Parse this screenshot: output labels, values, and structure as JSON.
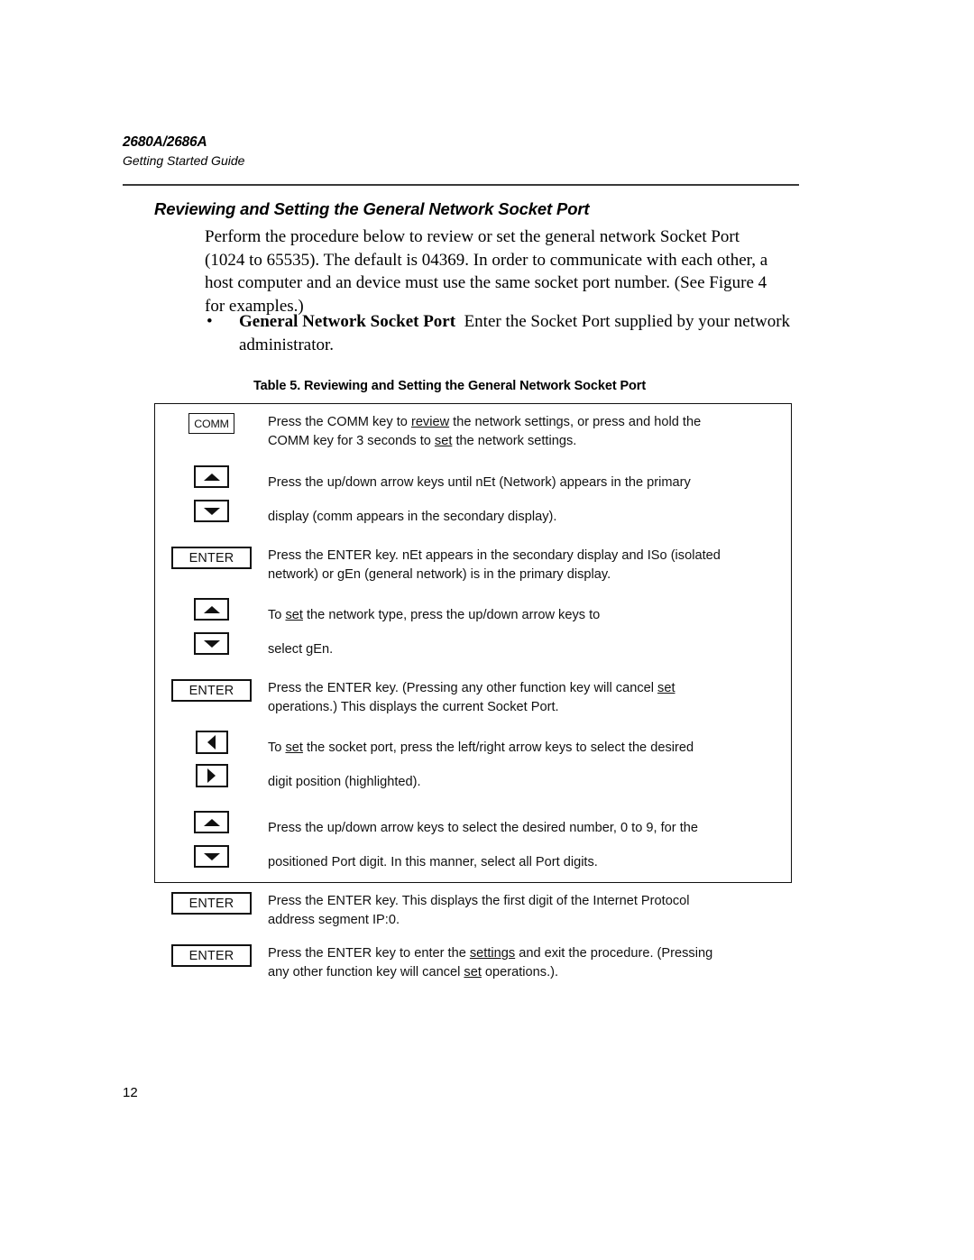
{
  "header": {
    "model": "2680A/2686A",
    "subtitle": "Getting Started Guide"
  },
  "section": {
    "heading": "Reviewing and Setting the General Network Socket Port",
    "paragraph_lines": [
      "Perform the procedure below to review or set the general network Socket Port",
      "(1024 to 65535). The default is 04369. In order to communicate with each other, a",
      "host computer and an device must use the same socket port number. (See Figure 4",
      "for examples.)"
    ],
    "bullet": {
      "marker": "•",
      "term": "General Network Socket Port",
      "text_line1": "Enter the Socket Port supplied by your",
      "text_line2": "network administrator."
    }
  },
  "table": {
    "caption": "Table 5. Reviewing and Setting the General Network Socket Port",
    "keys": {
      "comm": "COMM",
      "enter": "ENTER",
      "arrow_up": "up-arrow",
      "arrow_down": "down-arrow",
      "arrow_left": "left-arrow",
      "arrow_right": "right-arrow"
    },
    "rows": [
      {
        "key_type": "comm",
        "key_label": "COMM",
        "lines": [
          [
            {
              "t": "Press the COMM key to "
            },
            {
              "t": "review",
              "u": true
            },
            {
              "t": " the network settings, or press and hold the"
            }
          ],
          [
            {
              "t": "COMM key for 3 seconds to "
            },
            {
              "t": "set",
              "u": true
            },
            {
              "t": " the network settings."
            }
          ]
        ]
      },
      {
        "key_type": "updown",
        "lines": [
          [
            {
              "t": "Press the up/down arrow keys until nEt (Network) appears in the primary"
            }
          ],
          [
            {
              "t": "display (comm appears in the secondary display)."
            }
          ]
        ]
      },
      {
        "key_type": "enter",
        "key_label": "ENTER",
        "lines": [
          [
            {
              "t": "Press the ENTER key. nEt appears in the secondary display and ISo (isolated"
            }
          ],
          [
            {
              "t": "network) or gEn (general network) is in the primary display."
            }
          ]
        ]
      },
      {
        "key_type": "updown",
        "lines": [
          [
            {
              "t": "To "
            },
            {
              "t": "set",
              "u": true
            },
            {
              "t": " the network type, press the up/down arrow keys to"
            }
          ],
          [
            {
              "t": "select gEn."
            }
          ]
        ]
      },
      {
        "key_type": "enter",
        "key_label": "ENTER",
        "lines": [
          [
            {
              "t": "Press the ENTER key. (Pressing any other function key will cancel "
            },
            {
              "t": "set",
              "u": true
            }
          ],
          [
            {
              "t": "operations.) This displays the current Socket Port."
            }
          ]
        ]
      },
      {
        "key_type": "leftright",
        "lines": [
          [
            {
              "t": "To "
            },
            {
              "t": "set",
              "u": true
            },
            {
              "t": " the socket port, press the left/right arrow keys to select the desired"
            }
          ],
          [
            {
              "t": "digit position (highlighted)."
            }
          ]
        ]
      },
      {
        "key_type": "updown",
        "lines": [
          [
            {
              "t": "Press the up/down arrow keys to select the desired number, 0 to 9, for the"
            }
          ],
          [
            {
              "t": "positioned Port digit. In this manner, select all Port digits."
            }
          ]
        ]
      },
      {
        "key_type": "enter",
        "key_label": "ENTER",
        "lines": [
          [
            {
              "t": "Press the ENTER key. This displays the first digit of the Internet Protocol"
            }
          ],
          [
            {
              "t": "address segment IP:0."
            }
          ]
        ]
      },
      {
        "key_type": "enter",
        "key_label": "ENTER",
        "lines": [
          [
            {
              "t": "Press the ENTER key to enter the "
            },
            {
              "t": "settings",
              "u": true
            },
            {
              "t": " and exit the procedure. (Pressing"
            }
          ],
          [
            {
              "t": "any other function key will cancel "
            },
            {
              "t": "set",
              "u": true
            },
            {
              "t": " operations.)."
            }
          ]
        ]
      }
    ]
  },
  "footer": {
    "page_number": "12"
  }
}
